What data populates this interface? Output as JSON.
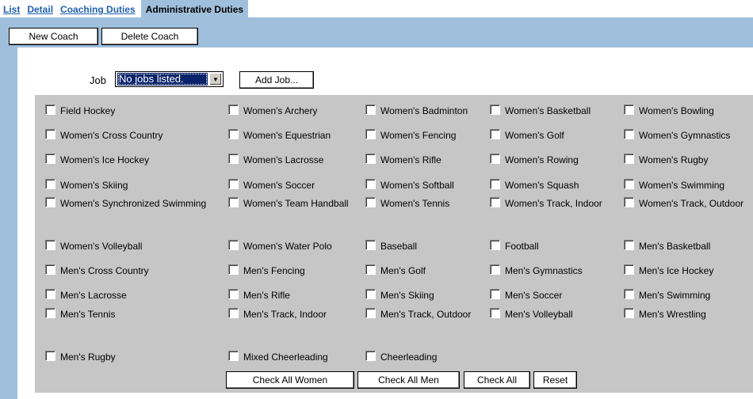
{
  "tabs": [
    {
      "label": "List",
      "active": false
    },
    {
      "label": "Detail",
      "active": false
    },
    {
      "label": "Coaching Duties",
      "active": false
    },
    {
      "label": "Administrative Duties",
      "active": true
    }
  ],
  "toolbar": {
    "new_coach_label": "New Coach",
    "delete_coach_label": "Delete Coach"
  },
  "job": {
    "label": "Job",
    "selected_value": "No jobs listed.",
    "add_job_label": "Add Job..."
  },
  "sports": [
    "Field Hockey",
    "Women's Archery",
    "Women's Badminton",
    "Women's Basketball",
    "Women's Bowling",
    "Women's Cross Country",
    "Women's Equestrian",
    "Women's Fencing",
    "Women's Golf",
    "Women's Gymnastics",
    "Women's Ice Hockey",
    "Women's Lacrosse",
    "Women's Rifle",
    "Women's Rowing",
    "Women's Rugby",
    "Women's Skiing",
    "Women's Soccer",
    "Women's Softball",
    "Women's Squash",
    "Women's Swimming",
    "Women's Synchronized Swimming",
    "Women's Team Handball",
    "Women's Tennis",
    "Women's Track, Indoor",
    "Women's Track, Outdoor",
    "Women's Volleyball",
    "Women's Water Polo",
    "Baseball",
    "Football",
    "Men's Basketball",
    "Men's Cross Country",
    "Men's Fencing",
    "Men's Golf",
    "Men's Gymnastics",
    "Men's Ice Hockey",
    "Men's Lacrosse",
    "Men's Rifle",
    "Men's Skiing",
    "Men's Soccer",
    "Men's Swimming",
    "Men's Tennis",
    "Men's Track, Indoor",
    "Men's Track, Outdoor",
    "Men's Volleyball",
    "Men's Wrestling",
    "Men's Rugby",
    "Mixed Cheerleading",
    "Cheerleading"
  ],
  "actions": {
    "check_all_women": "Check All Women",
    "check_all_men": "Check All Men",
    "check_all": "Check All",
    "reset": "Reset"
  },
  "colors": {
    "band": "#9fbfdc",
    "grid": "#c6c6c6",
    "link": "#1f5fae",
    "selection": "#0a246a"
  }
}
